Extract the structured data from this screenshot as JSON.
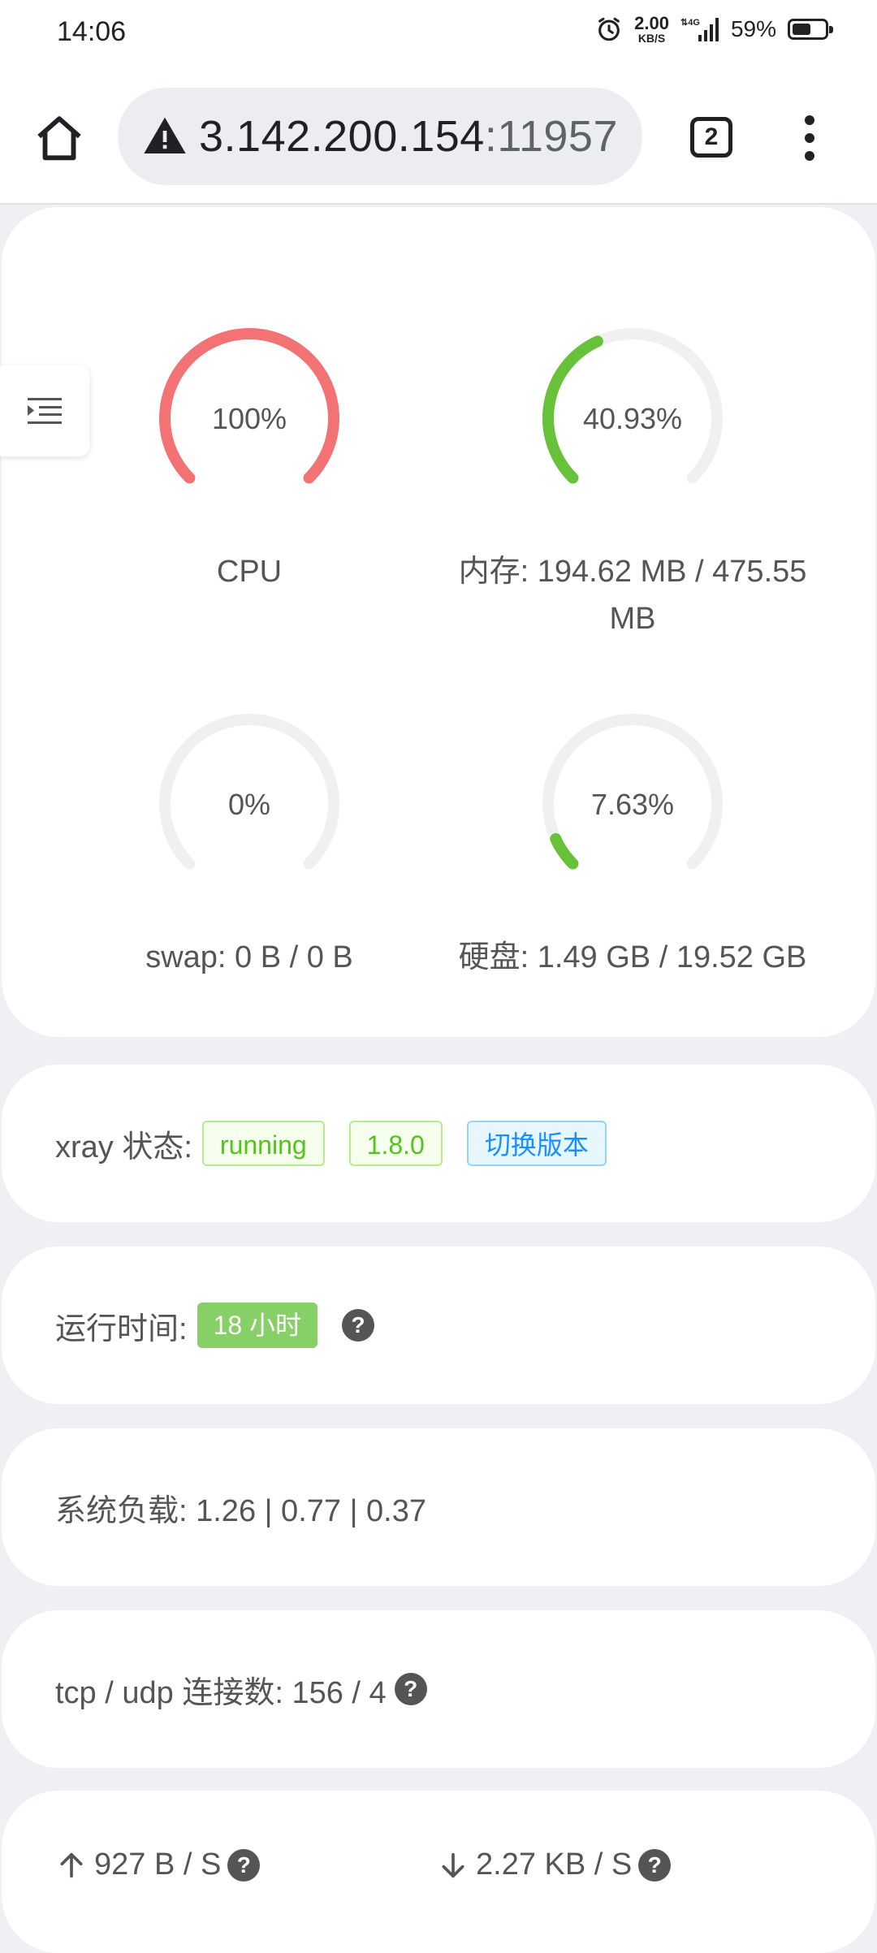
{
  "status_bar": {
    "time": "14:06",
    "net_speed_value": "2.00",
    "net_speed_unit": "KB/S",
    "battery_percent": "59%",
    "battery_level": 0.59
  },
  "browser": {
    "url_host": "3.142.200.154",
    "url_port": ":11957",
    "tab_count": "2"
  },
  "gauges": [
    {
      "value_text": "100%",
      "percent": 100,
      "label": "CPU",
      "color": "#f37374"
    },
    {
      "value_text": "40.93%",
      "percent": 40.93,
      "label": "内存: 194.62 MB / 475.55 MB",
      "color": "#67c23a"
    },
    {
      "value_text": "0%",
      "percent": 0,
      "label": "swap: 0 B / 0 B",
      "color": "#67c23a"
    },
    {
      "value_text": "7.63%",
      "percent": 7.63,
      "label": "硬盘: 1.49 GB / 19.52 GB",
      "color": "#67c23a"
    }
  ],
  "xray": {
    "label": "xray 状态:",
    "status": "running",
    "version": "1.8.0",
    "switch_button": "切换版本"
  },
  "uptime": {
    "label": "运行时间:",
    "value": "18 小时"
  },
  "load": {
    "text": "系统负载: 1.26 | 0.77 | 0.37"
  },
  "connections": {
    "text": "tcp / udp 连接数: 156 / 4"
  },
  "network": {
    "upload": "927 B / S",
    "download": "2.27 KB / S"
  },
  "icons": {
    "home": "home-icon",
    "warning": "warning-icon",
    "menu": "more-vert-icon",
    "sidebar": "menu-fold-icon",
    "help": "question-icon",
    "upload": "arrow-up-icon",
    "download": "arrow-down-icon"
  },
  "colors": {
    "cpu": "#f37374",
    "ok": "#67c23a",
    "track": "#f0f0f0",
    "background": "#eff0f3"
  }
}
